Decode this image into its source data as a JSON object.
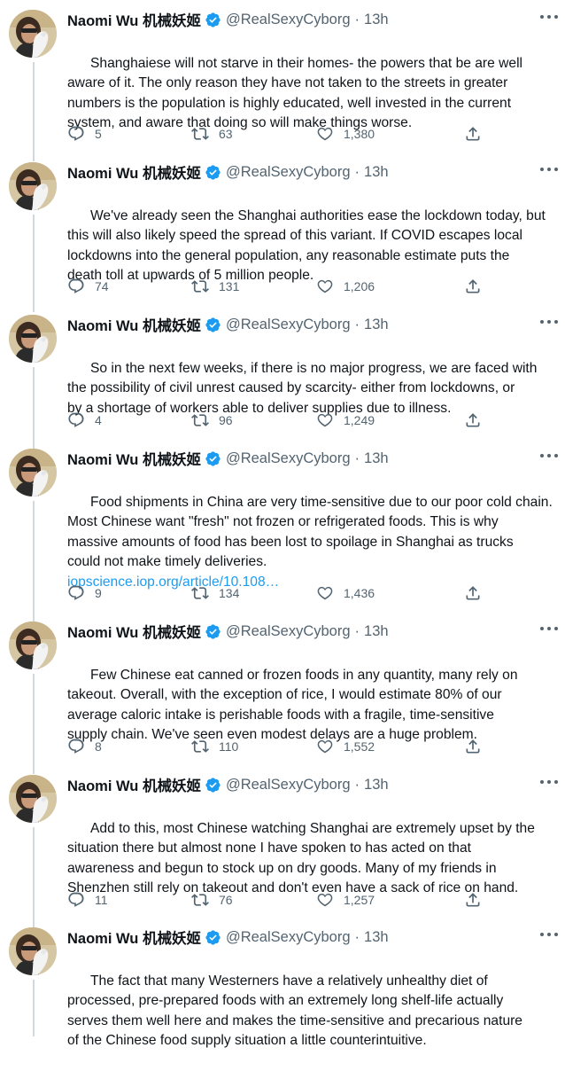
{
  "author": {
    "name": "Naomi Wu 机械妖姬",
    "handle": "@RealSexyCyborg",
    "time": "13h",
    "verified": true
  },
  "colors": {
    "text": "#0f1419",
    "secondary": "#536471",
    "link": "#1d9bf0",
    "verified": "#1d9bf0",
    "thread_line": "#cfd9de"
  },
  "tweets": [
    {
      "text": "Shanghaiese will not starve in their homes- the powers that be are well\naware of it. The only reason they have not taken to the streets in greater\nnumbers is the population is highly educated, well invested in the current\nsystem, and aware that doing so will make things worse.",
      "link": "",
      "replies": "5",
      "retweets": "63",
      "likes": "1,380"
    },
    {
      "text": "We've already seen the Shanghai authorities ease the lockdown today, but\nthis will also likely speed the spread of this variant. If COVID escapes local\nlockdowns into the general population, any reasonable estimate puts the\ndeath toll at upwards of 5 million people.",
      "link": "",
      "replies": "74",
      "retweets": "131",
      "likes": "1,206"
    },
    {
      "text": "So in the next few weeks, if there is no major progress, we are faced with\nthe possibility of civil unrest caused by scarcity- either from lockdowns, or\nby a shortage of workers able to deliver supplies due to illness.",
      "link": "",
      "replies": "4",
      "retweets": "96",
      "likes": "1,249"
    },
    {
      "text": "Food shipments in China are very time-sensitive due to our poor cold chain.\nMost Chinese want \"fresh\" not frozen or refrigerated foods. This is why\nmassive amounts of food has been lost to spoilage in Shanghai as trucks\ncould not make timely deliveries.",
      "link": "iopscience.iop.org/article/10.108…",
      "replies": "9",
      "retweets": "134",
      "likes": "1,436"
    },
    {
      "text": "Few Chinese eat canned or frozen foods in any quantity, many rely on\ntakeout. Overall, with the exception of rice, I would estimate 80% of our\naverage caloric intake is perishable foods with a fragile, time-sensitive\nsupply chain. We've seen even modest delays are a huge problem.",
      "link": "",
      "replies": "8",
      "retweets": "110",
      "likes": "1,552"
    },
    {
      "text": "Add to this, most Chinese watching Shanghai are extremely upset by the\nsituation there but almost none I have spoken to has acted on that\nawareness and begun to stock up on dry goods. Many of my friends in\nShenzhen still rely on takeout and don't even have a sack of rice on hand.",
      "link": "",
      "replies": "11",
      "retweets": "76",
      "likes": "1,257"
    },
    {
      "text": "The fact that many Westerners have a relatively unhealthy diet of\nprocessed, pre-prepared foods with an extremely long shelf-life actually\nserves them well here and makes the time-sensitive and precarious nature\nof the Chinese food supply situation a little counterintuitive.",
      "link": "",
      "replies": "",
      "retweets": "",
      "likes": ""
    }
  ]
}
